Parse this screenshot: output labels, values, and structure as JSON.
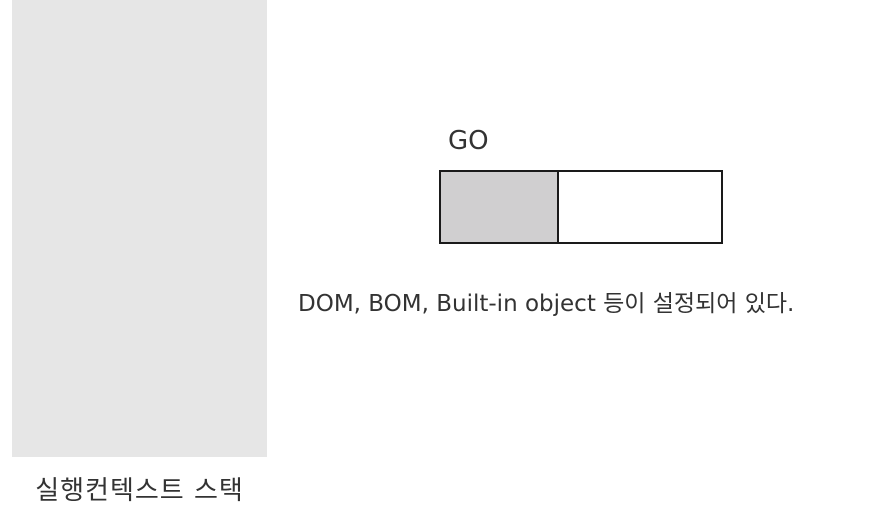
{
  "execution_context_stack": {
    "caption": "실행컨텍스트 스택"
  },
  "global_object": {
    "label": "GO",
    "fill_color": "#d0cfd0"
  },
  "description": "DOM, BOM, Built-in object 등이 설정되어 있다."
}
